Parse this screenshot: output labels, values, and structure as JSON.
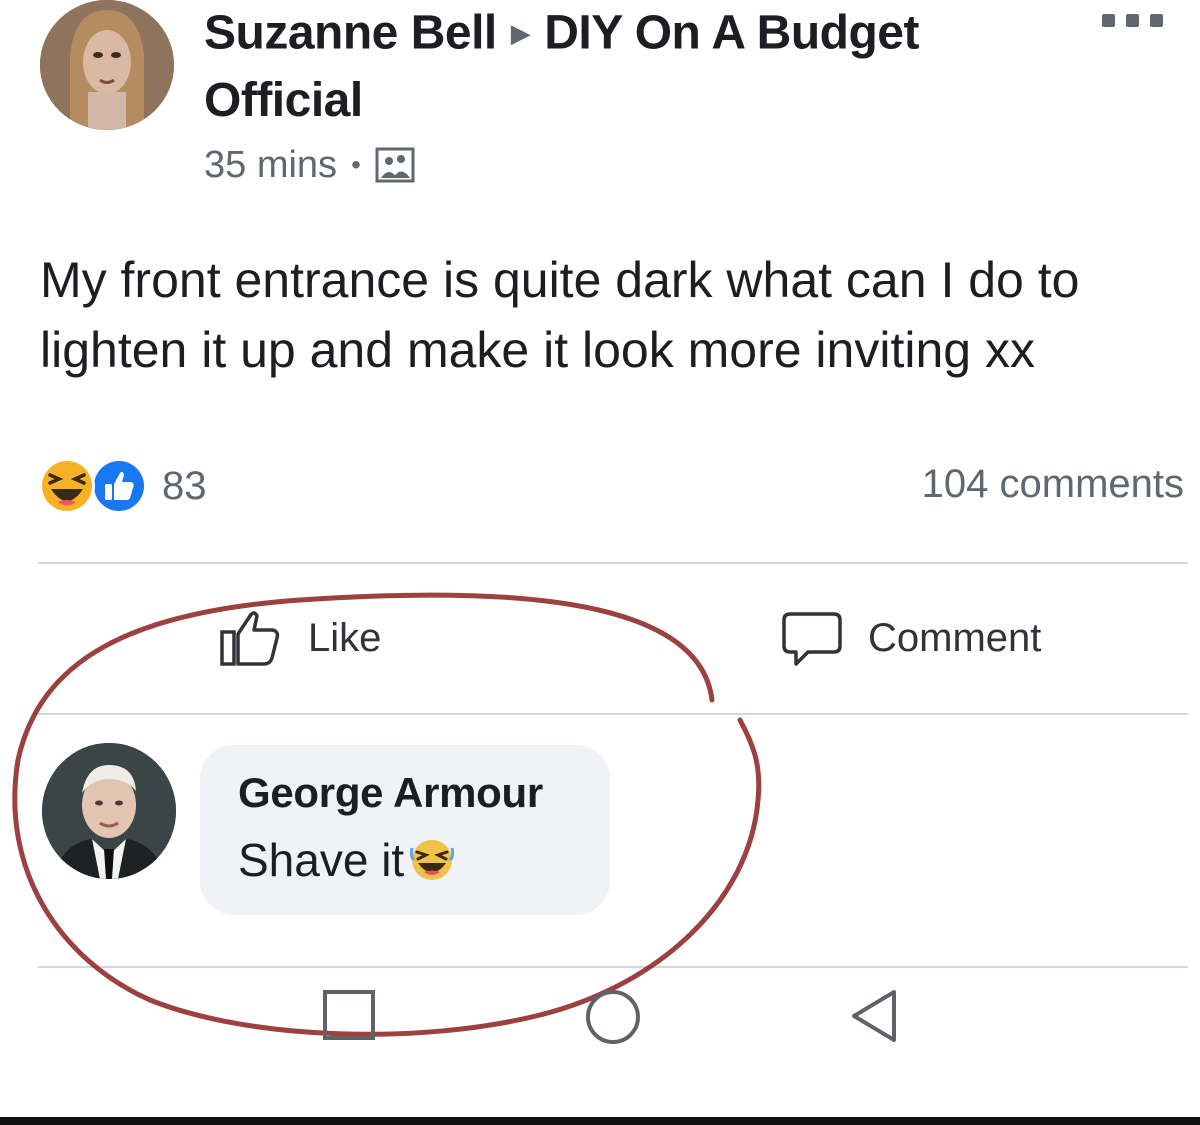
{
  "post": {
    "author": "Suzanne Bell",
    "group": "DIY On A Budget Official",
    "time": "35 mins",
    "text": "My front entrance is quite dark what can I do to lighten it up and make it look more inviting xx",
    "reaction_count": "83",
    "comments_count": "104 comments",
    "reaction_icons": [
      "haha-reaction-icon",
      "like-reaction-icon"
    ]
  },
  "actions": {
    "like_label": "Like",
    "comment_label": "Comment"
  },
  "comment": {
    "author": "George Armour",
    "text": "Shave it",
    "emoji": "laughing-emoji-icon"
  },
  "navbar": {
    "items": [
      "recent-apps-icon",
      "home-icon",
      "back-icon"
    ]
  },
  "colors": {
    "text_primary": "#1c1e21",
    "text_secondary": "#606770",
    "bubble": "#f0f2f5",
    "like_blue": "#1877f2",
    "haha_yellow": "#f7b125",
    "annotation_red": "#8b1e1e"
  }
}
